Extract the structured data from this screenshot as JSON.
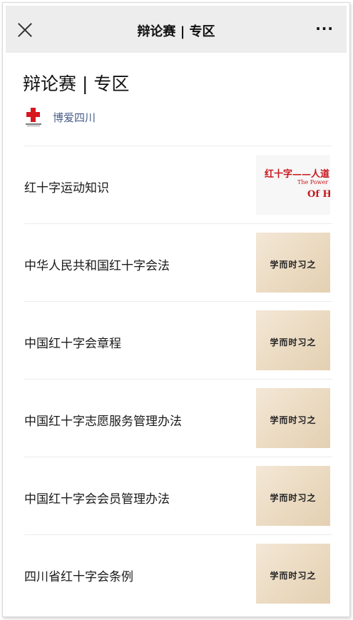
{
  "topbar": {
    "title": "辩论赛 | 专区",
    "more_label": "···"
  },
  "page": {
    "title": "辩论赛 | 专区",
    "publisher": "博爱四川"
  },
  "articles": [
    {
      "title": "红十字运动知识",
      "thumb": {
        "line1": "红十字——人道",
        "line2": "The Power",
        "line3": "Of Hu"
      }
    },
    {
      "title": "中华人民共和国红十字会法",
      "thumb_text": "学而时习之"
    },
    {
      "title": "中国红十字会章程",
      "thumb_text": "学而时习之"
    },
    {
      "title": "中国红十字志愿服务管理办法",
      "thumb_text": "学而时习之"
    },
    {
      "title": "中国红十字会会员管理办法",
      "thumb_text": "学而时习之"
    },
    {
      "title": "四川省红十字会条例",
      "thumb_text": "学而时习之"
    }
  ],
  "colors": {
    "accent_red": "#d7181f",
    "link_blue": "#4a5f8a",
    "topbar_bg": "#ededed"
  },
  "icons": [
    "close-icon",
    "more-icon",
    "red-cross-logo-icon"
  ]
}
